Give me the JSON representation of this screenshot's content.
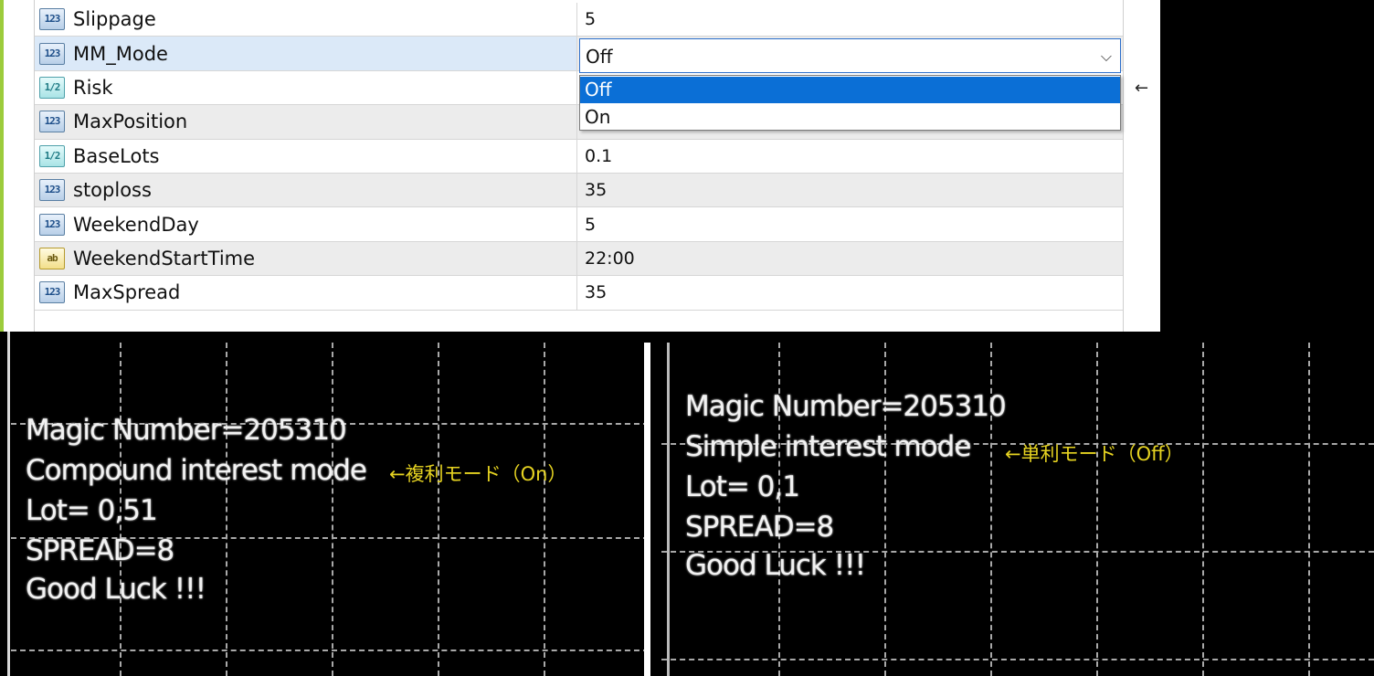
{
  "params": [
    {
      "name": "Slippage",
      "value": "5",
      "type": "123"
    },
    {
      "name": "MM_Mode",
      "value": "",
      "type": "123"
    },
    {
      "name": "Risk",
      "value": "",
      "type": "1/2"
    },
    {
      "name": "MaxPosition",
      "value": "",
      "type": "123"
    },
    {
      "name": "BaseLots",
      "value": "0.1",
      "type": "1/2"
    },
    {
      "name": "stoploss",
      "value": "35",
      "type": "123"
    },
    {
      "name": "WeekendDay",
      "value": "5",
      "type": "123"
    },
    {
      "name": "WeekendStartTime",
      "value": "22:00",
      "type": "ab"
    },
    {
      "name": "MaxSpread",
      "value": "35",
      "type": "123"
    }
  ],
  "dropdown": {
    "selected": "Off",
    "options": [
      "Off",
      "On"
    ],
    "arrow_note": "←"
  },
  "icons": {
    "int": "123",
    "dbl": "1/2",
    "str": "ab",
    "chevron": "⌵"
  },
  "chart_left": {
    "lines": [
      "Magic Number=205310",
      "Compound interest mode",
      "Lot= 0,51",
      "SPREAD=8",
      "Good Luck !!!"
    ],
    "note": "←複利モード（On）"
  },
  "chart_right": {
    "lines": [
      "Magic Number=205310",
      "Simple interest mode",
      "Lot= 0,1",
      "SPREAD=8",
      "Good Luck !!!"
    ],
    "note": "←単利モード（Off）"
  }
}
